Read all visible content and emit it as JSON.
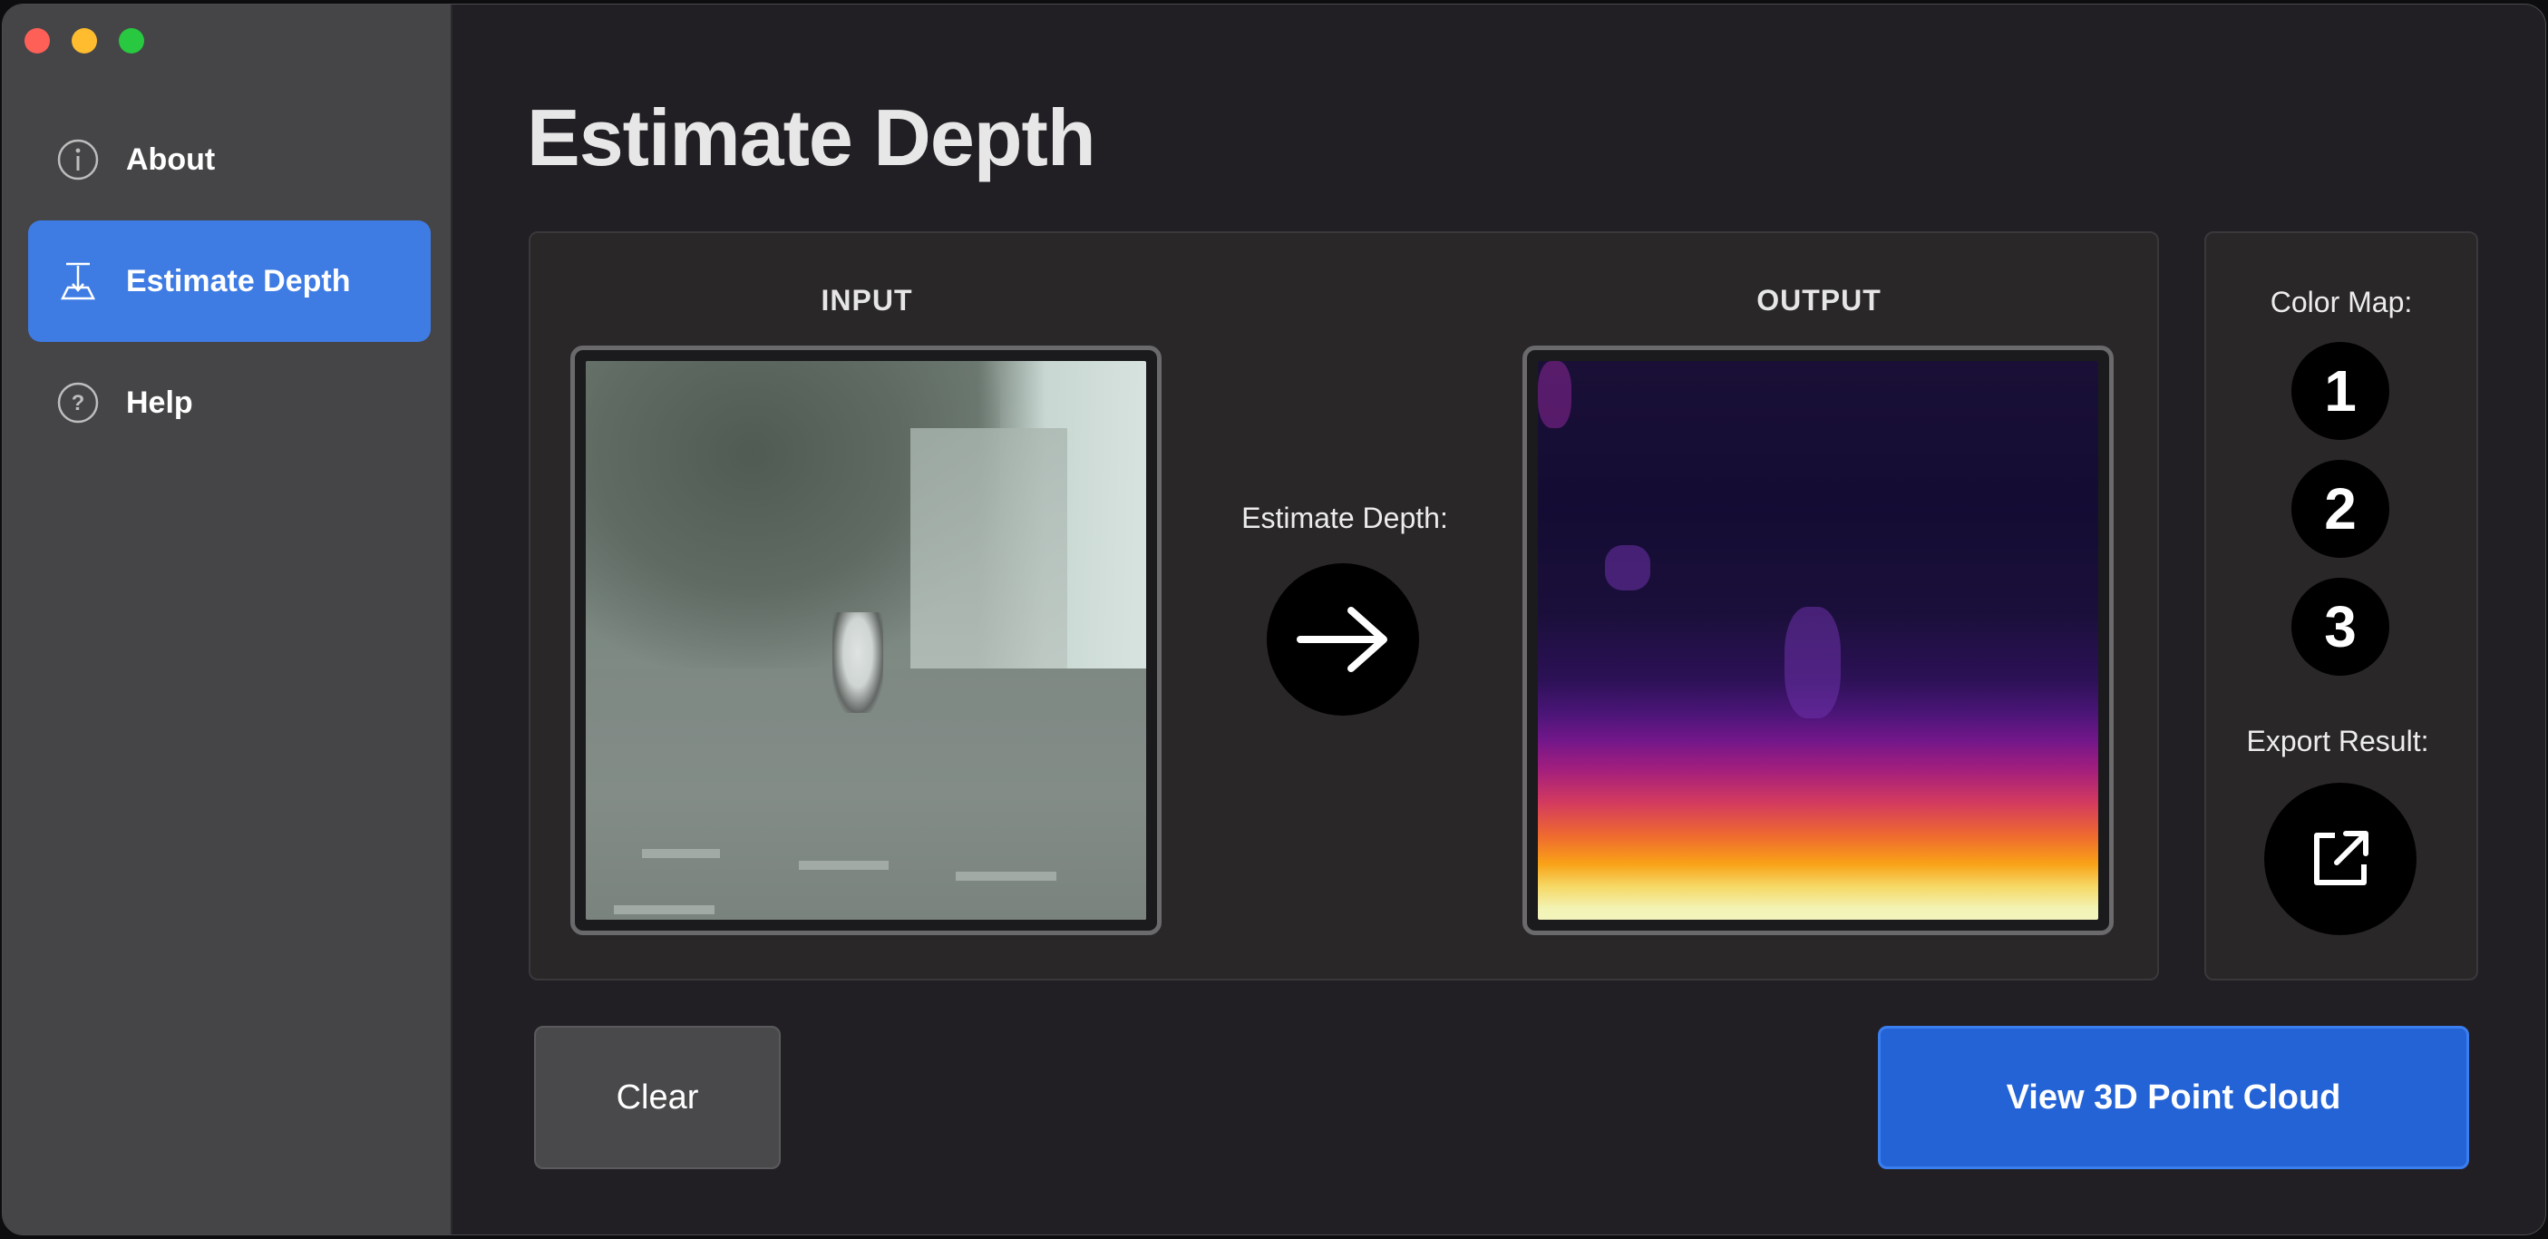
{
  "window": {
    "traffic_lights": [
      "close",
      "minimize",
      "zoom"
    ]
  },
  "sidebar": {
    "items": [
      {
        "label": "About",
        "icon": "info-icon",
        "active": false
      },
      {
        "label": "Estimate Depth",
        "icon": "depth-tool-icon",
        "active": true
      },
      {
        "label": "Help",
        "icon": "question-icon",
        "active": false
      }
    ]
  },
  "main": {
    "title": "Estimate Depth",
    "input_label": "INPUT",
    "output_label": "OUTPUT",
    "estimate_label": "Estimate Depth:",
    "estimate_button_icon": "arrow-right-icon"
  },
  "options": {
    "color_map_label": "Color Map:",
    "color_map_options": [
      "1",
      "2",
      "3"
    ],
    "export_label": "Export Result:",
    "export_icon": "export-icon"
  },
  "actions": {
    "clear_label": "Clear",
    "view_cloud_label": "View 3D Point Cloud"
  },
  "colors": {
    "accent_sidebar": "#3e7ce4",
    "accent_button": "#2463d6",
    "background": "#221f24",
    "sidebar": "#454547"
  }
}
